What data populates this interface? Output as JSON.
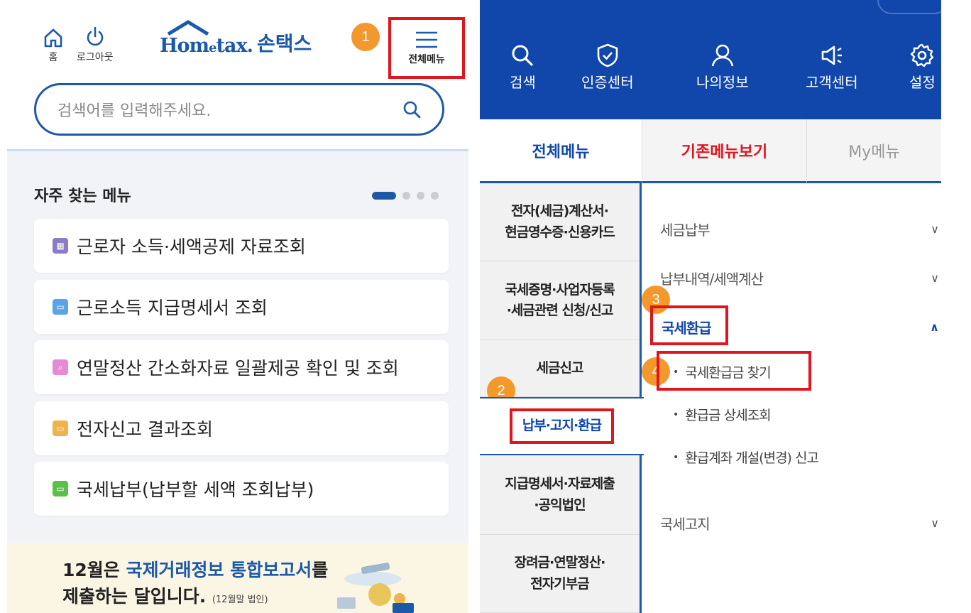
{
  "left": {
    "header": {
      "home_label": "홈",
      "logout_label": "로그아웃",
      "brand_hometax_prefix": "Hom",
      "brand_hometax_e": "e",
      "brand_hometax_suffix": "tax.",
      "brand_sontax": "손택스",
      "menu_label": "전체메뉴"
    },
    "search": {
      "placeholder": "검색어를 입력해주세요."
    },
    "faq": {
      "title": "자주 찾는 메뉴",
      "items": [
        {
          "label": "근로자 소득·세액공제 자료조회",
          "color": "#8b7bc8"
        },
        {
          "label": "근로소득 지급명세서 조회",
          "color": "#5aa3e6"
        },
        {
          "label": "연말정산 간소화자료 일괄제공 확인 및 조회",
          "color": "#e58ad6"
        },
        {
          "label": "전자신고 결과조회",
          "color": "#f0b24a"
        },
        {
          "label": "국세납부(납부할 세액 조회납부)",
          "color": "#5cbf4a"
        }
      ]
    },
    "banner": {
      "line1_pre": "12월은 ",
      "line1_hl": "국제거래정보 통합보고서",
      "line1_post": "를",
      "line2": "제출하는 달입니다.",
      "line2_small": "(12월말 법인)"
    }
  },
  "right": {
    "topbar": [
      {
        "label": "검색",
        "icon": "search-icon"
      },
      {
        "label": "인증센터",
        "icon": "shield-check-icon"
      },
      {
        "label": "나의정보",
        "icon": "user-icon"
      },
      {
        "label": "고객센터",
        "icon": "megaphone-icon"
      },
      {
        "label": "설정",
        "icon": "gear-icon"
      }
    ],
    "tabs": {
      "all": "전체메뉴",
      "classic": "기존메뉴보기",
      "my": "My메뉴"
    },
    "categories": [
      {
        "line1": "전자(세금)계산서·",
        "line2": "현금영수증·신용카드"
      },
      {
        "line1": "국세증명·사업자등록",
        "line2": "·세금관련 신청/신고"
      },
      {
        "line1": "세금신고",
        "line2": ""
      },
      {
        "line1": "납부·고지·환급",
        "line2": ""
      },
      {
        "line1": "지급명세서·자료제출",
        "line2": "·공익법인"
      },
      {
        "line1": "장려금·연말정산·",
        "line2": "전자기부금"
      }
    ],
    "submenu": {
      "pay": "세금납부",
      "history": "납부내역/세액계산",
      "refund": "국세환급",
      "refund_children": [
        "국세환급금 찾기",
        "환급금 상세조회",
        "환급계좌 개설(변경) 신고"
      ],
      "notice": "국세고지"
    }
  },
  "badges": [
    "1",
    "2",
    "3",
    "4"
  ],
  "colors": {
    "brand_blue": "#1147ab",
    "highlight_red": "#e0151e",
    "badge_orange": "#f3982c"
  }
}
